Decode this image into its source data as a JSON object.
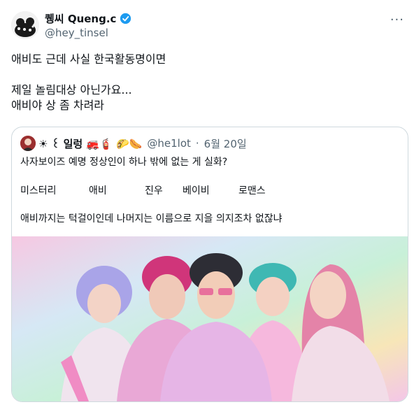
{
  "tweet": {
    "author_name": "퀭씨 Queng.c",
    "handle": "@hey_tinsel",
    "more_icon": "more-icon",
    "lines": [
      "애비도 근데 사실 한국활동명이면",
      "제일 놀림대상 아닌가요...",
      "애비야 상 좀 차려라"
    ]
  },
  "quote": {
    "author_name": "☀ ꒰ 일렁 🚒🧯 🌮🌭",
    "handle": "@he1lot",
    "separator": "·",
    "date": "6월 20일",
    "text": "사자보이즈 예명 정상인이 하나 밖에 없는 게 실화?",
    "names": [
      "미스터리",
      "애비",
      "진우",
      "베이비",
      "로맨스"
    ],
    "last_line": "애비까지는 턱걸이인데 나머지는 이름으로 지을 의지조차 없잖냐"
  },
  "colors": {
    "verified": "#1d9bf0",
    "muted": "#536471",
    "border": "#cfd9de"
  }
}
